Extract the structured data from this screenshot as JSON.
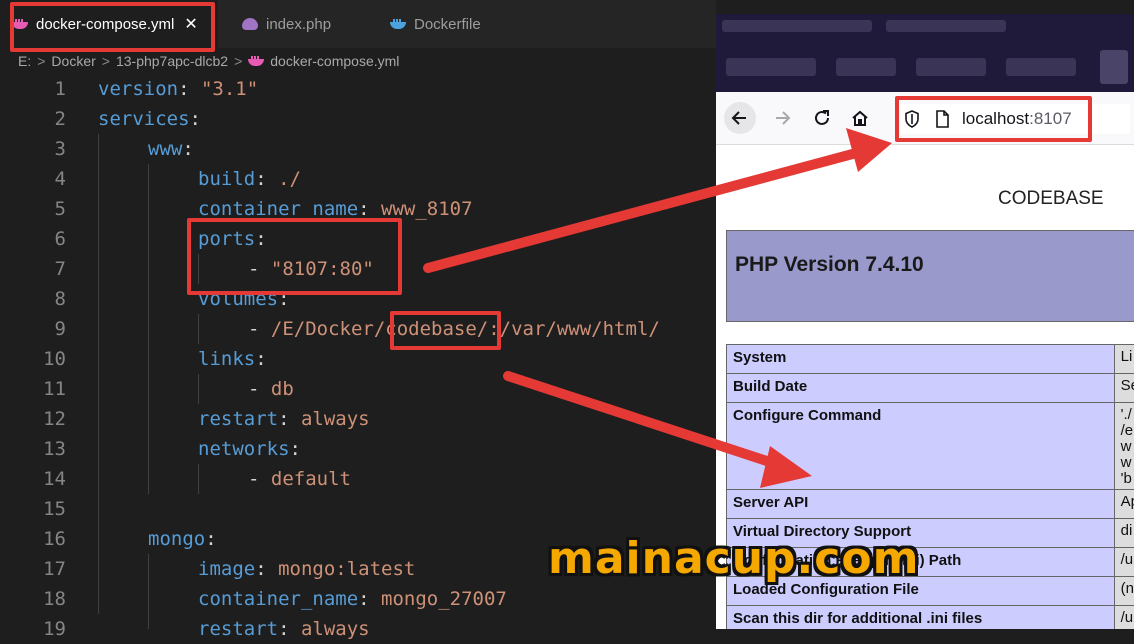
{
  "colors": {
    "editor_bg": "#1e1e1e",
    "keyword": "#569cd6",
    "string": "#ce9178",
    "highlight": "#e53935",
    "docker_icon": "#e85bb5",
    "dockerfile_icon": "#4aa3df",
    "php_icon": "#a074c4"
  },
  "editor": {
    "tabs": [
      {
        "label": "docker-compose.yml",
        "icon": "docker-whale-icon",
        "close": "✕"
      },
      {
        "label": "index.php",
        "icon": "php-elephant-icon"
      },
      {
        "label": "Dockerfile",
        "icon": "docker-whale-icon"
      }
    ],
    "breadcrumb": {
      "parts": [
        "E:",
        "Docker",
        "13-php7apc-dlcb2"
      ],
      "file": "docker-compose.yml",
      "sep": ">"
    },
    "lines": [
      {
        "n": "1",
        "t": [
          {
            "c": "k",
            "v": "version"
          },
          {
            "c": "p",
            "v": ": "
          },
          {
            "c": "s",
            "v": "\"3.1\""
          }
        ]
      },
      {
        "n": "2",
        "t": [
          {
            "c": "k",
            "v": "services"
          },
          {
            "c": "p",
            "v": ":"
          }
        ]
      },
      {
        "n": "3",
        "t": [
          {
            "c": "k",
            "v": "www"
          },
          {
            "c": "p",
            "v": ":"
          }
        ]
      },
      {
        "n": "4",
        "t": [
          {
            "c": "k",
            "v": "build"
          },
          {
            "c": "p",
            "v": ": "
          },
          {
            "c": "s",
            "v": "./"
          }
        ]
      },
      {
        "n": "5",
        "t": [
          {
            "c": "k",
            "v": "container_name"
          },
          {
            "c": "p",
            "v": ": "
          },
          {
            "c": "s",
            "v": "www_8107"
          }
        ]
      },
      {
        "n": "6",
        "t": [
          {
            "c": "k",
            "v": "ports"
          },
          {
            "c": "p",
            "v": ":"
          }
        ]
      },
      {
        "n": "7",
        "t": [
          {
            "c": "p",
            "v": "- "
          },
          {
            "c": "s",
            "v": "\"8107:80\""
          }
        ]
      },
      {
        "n": "8",
        "t": [
          {
            "c": "k",
            "v": "volumes"
          },
          {
            "c": "p",
            "v": ":"
          }
        ]
      },
      {
        "n": "9",
        "t": [
          {
            "c": "p",
            "v": "- "
          },
          {
            "c": "s",
            "v": "/E/Docker/codebase/:/var/www/html/"
          }
        ]
      },
      {
        "n": "10",
        "t": [
          {
            "c": "k",
            "v": "links"
          },
          {
            "c": "p",
            "v": ":"
          }
        ]
      },
      {
        "n": "11",
        "t": [
          {
            "c": "p",
            "v": "- "
          },
          {
            "c": "s",
            "v": "db"
          }
        ]
      },
      {
        "n": "12",
        "t": [
          {
            "c": "k",
            "v": "restart"
          },
          {
            "c": "p",
            "v": ": "
          },
          {
            "c": "s",
            "v": "always"
          }
        ]
      },
      {
        "n": "13",
        "t": [
          {
            "c": "k",
            "v": "networks"
          },
          {
            "c": "p",
            "v": ":"
          }
        ]
      },
      {
        "n": "14",
        "t": [
          {
            "c": "p",
            "v": "- "
          },
          {
            "c": "s",
            "v": "default"
          }
        ]
      },
      {
        "n": "15",
        "t": []
      },
      {
        "n": "16",
        "t": [
          {
            "c": "k",
            "v": "mongo"
          },
          {
            "c": "p",
            "v": ":"
          }
        ]
      },
      {
        "n": "17",
        "t": [
          {
            "c": "k",
            "v": "image"
          },
          {
            "c": "p",
            "v": ": "
          },
          {
            "c": "s",
            "v": "mongo:latest"
          }
        ]
      },
      {
        "n": "18",
        "t": [
          {
            "c": "k",
            "v": "container_name"
          },
          {
            "c": "p",
            "v": ": "
          },
          {
            "c": "s",
            "v": "mongo_27007"
          }
        ]
      },
      {
        "n": "19",
        "t": [
          {
            "c": "k",
            "v": "restart"
          },
          {
            "c": "p",
            "v": ": "
          },
          {
            "c": "s",
            "v": "always"
          }
        ]
      }
    ]
  },
  "browser": {
    "nav_icons": [
      "back-arrow-icon",
      "forward-arrow-icon",
      "reload-icon",
      "home-icon"
    ],
    "url_icons": [
      "shield-icon",
      "page-icon"
    ],
    "url_host": "localhost",
    "url_port": ":8107",
    "page_title": "CODEBASE",
    "php_version": "PHP Version 7.4.10",
    "table": [
      {
        "label": "System",
        "value": "Li"
      },
      {
        "label": "Build Date",
        "value": "Se"
      },
      {
        "label": "Configure Command",
        "value": "'./\n/e\nw\nw\n'b"
      },
      {
        "label": "Server API",
        "value": "Ap"
      },
      {
        "label": "Virtual Directory Support",
        "value": "di"
      },
      {
        "label": "Configuration File (php.ini) Path",
        "value": "/u"
      },
      {
        "label": "Loaded Configuration File",
        "value": "(n"
      },
      {
        "label": "Scan this dir for additional .ini files",
        "value": "/u"
      }
    ]
  },
  "watermark": "mainacup.com"
}
